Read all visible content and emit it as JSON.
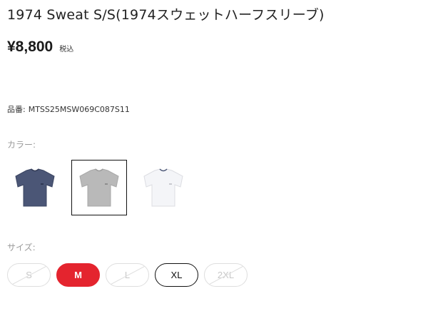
{
  "product": {
    "title": "1974 Sweat S/S(1974スウェットハーフスリーブ)",
    "price": "¥8,800",
    "tax_label": "税込",
    "sku_label": "品番:",
    "sku": "MTSS25MSW069C087S11"
  },
  "color": {
    "label": "カラー:",
    "swatches": [
      {
        "name": "navy",
        "color": "#4b5676",
        "selected": false
      },
      {
        "name": "gray",
        "color": "#b9b9b9",
        "selected": true
      },
      {
        "name": "white",
        "color": "#f4f5f8",
        "selected": false
      }
    ]
  },
  "size": {
    "label": "サイズ:",
    "options": [
      {
        "label": "S",
        "state": "unavailable"
      },
      {
        "label": "M",
        "state": "selected"
      },
      {
        "label": "L",
        "state": "unavailable"
      },
      {
        "label": "XL",
        "state": "available"
      },
      {
        "label": "2XL",
        "state": "unavailable"
      }
    ]
  },
  "colors": {
    "accent": "#e4242e",
    "muted": "#9a9a9a"
  }
}
